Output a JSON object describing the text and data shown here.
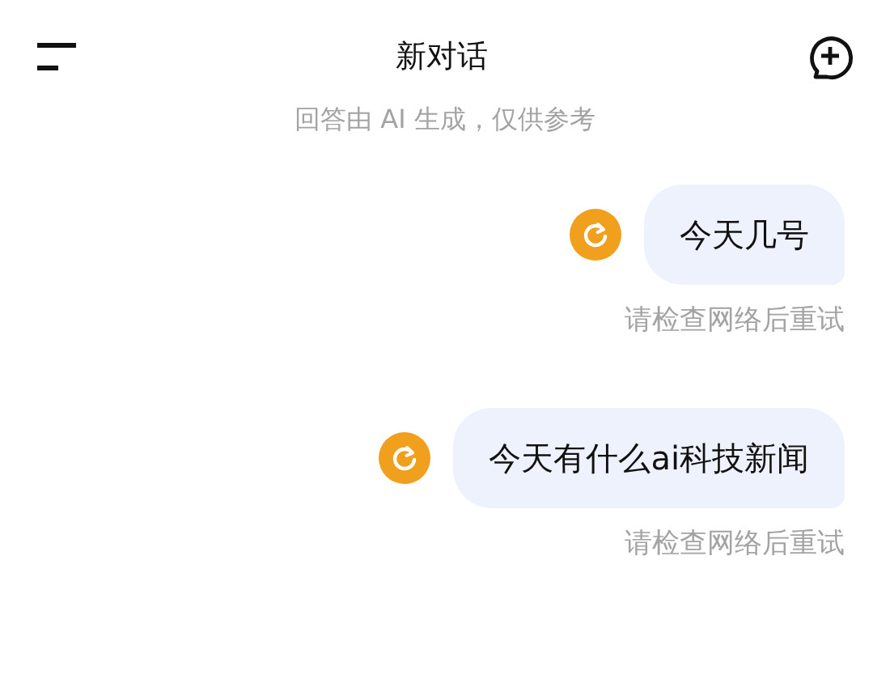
{
  "header": {
    "title": "新对话",
    "subtitle": "回答由 AI 生成，仅供参考"
  },
  "messages": [
    {
      "text": "今天几号",
      "failed": true,
      "error": "请检查网络后重试"
    },
    {
      "text": "今天有什么ai科技新闻",
      "failed": true,
      "error": "请检查网络后重试"
    }
  ]
}
